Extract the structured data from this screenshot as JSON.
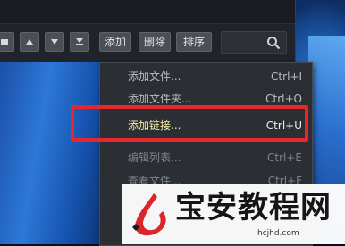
{
  "toolbar": {
    "add_label": "添加",
    "delete_label": "删除",
    "sort_label": "排序"
  },
  "context_menu": {
    "items": [
      {
        "label": "添加文件...",
        "shortcut": "Ctrl+I"
      },
      {
        "label": "添加文件夹...",
        "shortcut": "Ctrl+O"
      },
      {
        "label": "添加链接...",
        "shortcut": "Ctrl+U"
      },
      {
        "label": "编辑列表...",
        "shortcut": "Ctrl+E"
      },
      {
        "label": "查看文件...",
        "shortcut": "Ctrl+F"
      }
    ]
  },
  "watermark": {
    "text": "宝安教程网",
    "url": "hcjhd.com"
  },
  "colors": {
    "highlight_border": "#e8262b",
    "menu_bg": "#2b2e33",
    "toolbar_button": "#4a4e56",
    "logo_red": "#d9262b"
  },
  "icons": [
    "stop-icon",
    "move-up-icon",
    "move-down-icon",
    "move-bottom-icon",
    "search-icon",
    "logo-icon"
  ]
}
